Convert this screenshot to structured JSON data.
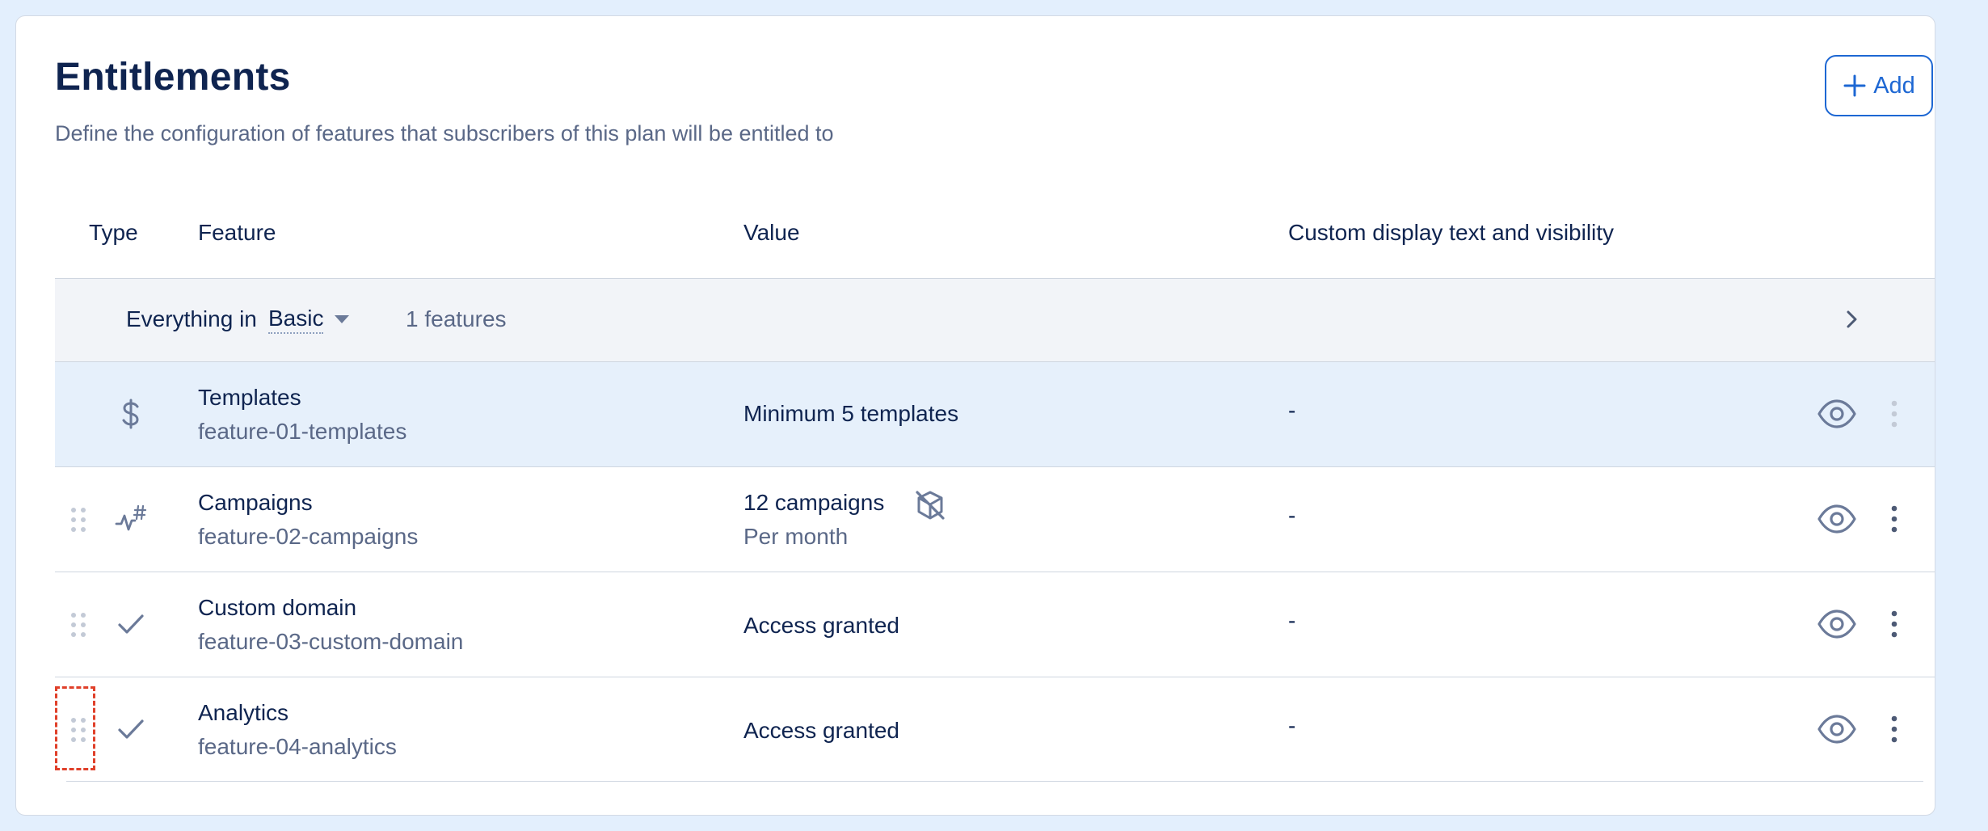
{
  "header": {
    "title": "Entitlements",
    "subtitle": "Define the configuration of features that subscribers of this plan will be entitled to",
    "add_label": "Add"
  },
  "table": {
    "columns": [
      "Type",
      "Feature",
      "Value",
      "Custom display text and visibility"
    ],
    "group": {
      "prefix": "Everything in",
      "plan": "Basic",
      "count": "1 features"
    },
    "rows": [
      {
        "type_icon": "dollar-icon",
        "name": "Templates",
        "id": "feature-01-templates",
        "value": "Minimum 5 templates",
        "value_sub": "",
        "custom": "-",
        "highlighted": true,
        "draggable": false
      },
      {
        "type_icon": "metered-icon",
        "name": "Campaigns",
        "id": "feature-02-campaigns",
        "value": "12 campaigns",
        "value_sub": "Per month",
        "value_badge": "no-overage-box-icon",
        "custom": "-",
        "highlighted": false,
        "draggable": true
      },
      {
        "type_icon": "check-icon",
        "name": "Custom domain",
        "id": "feature-03-custom-domain",
        "value": "Access granted",
        "value_sub": "",
        "custom": "-",
        "highlighted": false,
        "draggable": true
      },
      {
        "type_icon": "check-icon",
        "name": "Analytics",
        "id": "feature-04-analytics",
        "value": "Access granted",
        "value_sub": "",
        "custom": "-",
        "highlighted": false,
        "draggable": true
      }
    ]
  },
  "colors": {
    "page_bg": "#e3effd",
    "accent": "#1d67d3",
    "text_primary": "#0f2450",
    "text_secondary": "#5a6887",
    "highlight_row": "#e6f0fb",
    "focus_outline": "#e0402a"
  }
}
